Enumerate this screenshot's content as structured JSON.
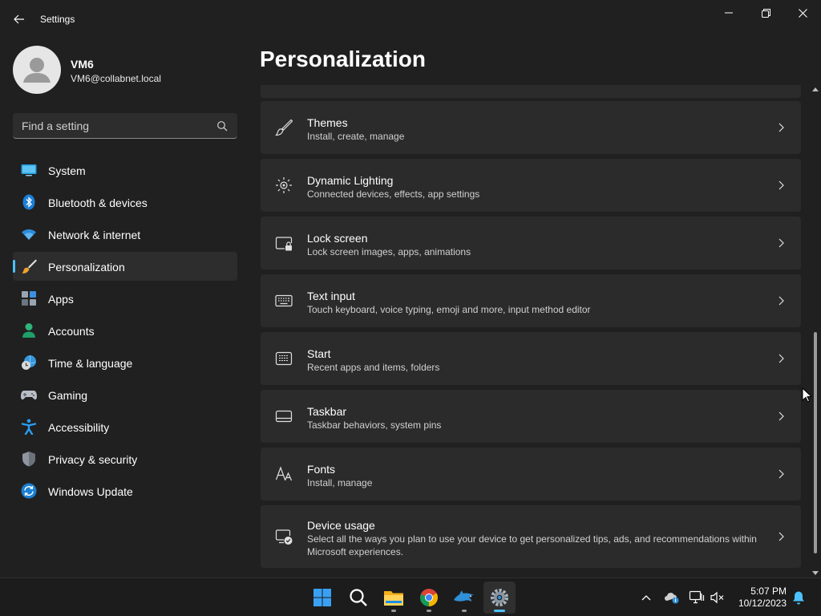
{
  "window": {
    "title": "Settings"
  },
  "user": {
    "name": "VM6",
    "email": "VM6@collabnet.local"
  },
  "search": {
    "placeholder": "Find a setting"
  },
  "sidebar": {
    "items": [
      {
        "label": "System",
        "icon": "system-icon"
      },
      {
        "label": "Bluetooth & devices",
        "icon": "bluetooth-icon"
      },
      {
        "label": "Network & internet",
        "icon": "wifi-icon"
      },
      {
        "label": "Personalization",
        "icon": "brush-icon",
        "selected": true
      },
      {
        "label": "Apps",
        "icon": "apps-icon"
      },
      {
        "label": "Accounts",
        "icon": "person-icon"
      },
      {
        "label": "Time & language",
        "icon": "globe-clock-icon"
      },
      {
        "label": "Gaming",
        "icon": "gamepad-icon"
      },
      {
        "label": "Accessibility",
        "icon": "accessibility-icon"
      },
      {
        "label": "Privacy & security",
        "icon": "shield-icon"
      },
      {
        "label": "Windows Update",
        "icon": "update-icon"
      }
    ]
  },
  "main": {
    "title": "Personalization",
    "rows": [
      {
        "title": "Themes",
        "description": "Install, create, manage",
        "icon": "brush-icon"
      },
      {
        "title": "Dynamic Lighting",
        "description": "Connected devices, effects, app settings",
        "icon": "lighting-icon"
      },
      {
        "title": "Lock screen",
        "description": "Lock screen images, apps, animations",
        "icon": "lock-screen-icon"
      },
      {
        "title": "Text input",
        "description": "Touch keyboard, voice typing, emoji and more, input method editor",
        "icon": "keyboard-icon"
      },
      {
        "title": "Start",
        "description": "Recent apps and items, folders",
        "icon": "start-icon"
      },
      {
        "title": "Taskbar",
        "description": "Taskbar behaviors, system pins",
        "icon": "taskbar-icon"
      },
      {
        "title": "Fonts",
        "description": "Install, manage",
        "icon": "fonts-icon"
      },
      {
        "title": "Device usage",
        "description": "Select all the ways you plan to use your device to get personalized tips, ads, and recommendations within Microsoft experiences.",
        "icon": "device-usage-icon"
      }
    ]
  },
  "taskbar": {
    "apps": [
      "windows-start-icon",
      "search-icon",
      "file-explorer-icon",
      "chrome-icon",
      "dolphin-icon",
      "settings-gear-icon"
    ],
    "time": "5:07 PM",
    "date": "10/12/2023"
  },
  "colors": {
    "accent": "#4cc2ff",
    "background": "#202020",
    "card": "#2b2b2b"
  }
}
